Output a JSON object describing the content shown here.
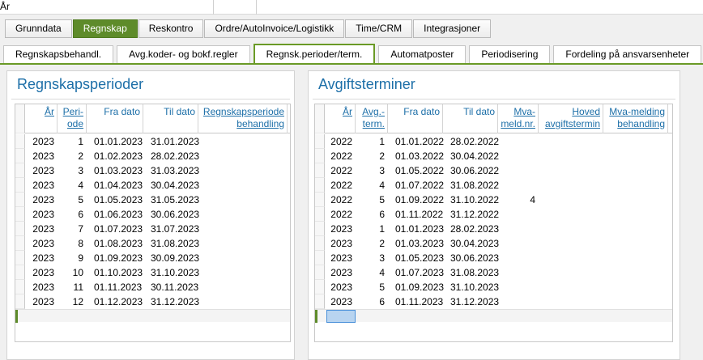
{
  "top_bar": {
    "label": "År"
  },
  "main_tabs": [
    {
      "label": "Grunndata",
      "active": false
    },
    {
      "label": "Regnskap",
      "active": true
    },
    {
      "label": "Reskontro",
      "active": false
    },
    {
      "label": "Ordre/AutoInvoice/Logistikk",
      "active": false
    },
    {
      "label": "Time/CRM",
      "active": false
    },
    {
      "label": "Integrasjoner",
      "active": false
    }
  ],
  "sub_tabs": [
    {
      "label": "Regnskapsbehandl.",
      "active": false
    },
    {
      "label": "Avg.koder- og bokf.regler",
      "active": false
    },
    {
      "label": "Regnsk.perioder/term.",
      "active": true
    },
    {
      "label": "Automatposter",
      "active": false
    },
    {
      "label": "Periodisering",
      "active": false
    },
    {
      "label": "Fordeling på ansvarsenheter",
      "active": false
    }
  ],
  "periods_panel": {
    "title": "Regnskapsperioder",
    "headers": [
      "År",
      "Peri-\node",
      "Fra dato",
      "Til dato",
      "Regnskapsperiode\nbehandling"
    ],
    "rows": [
      [
        "2023",
        "1",
        "01.01.2023",
        "31.01.2023",
        ""
      ],
      [
        "2023",
        "2",
        "01.02.2023",
        "28.02.2023",
        ""
      ],
      [
        "2023",
        "3",
        "01.03.2023",
        "31.03.2023",
        ""
      ],
      [
        "2023",
        "4",
        "01.04.2023",
        "30.04.2023",
        ""
      ],
      [
        "2023",
        "5",
        "01.05.2023",
        "31.05.2023",
        ""
      ],
      [
        "2023",
        "6",
        "01.06.2023",
        "30.06.2023",
        ""
      ],
      [
        "2023",
        "7",
        "01.07.2023",
        "31.07.2023",
        ""
      ],
      [
        "2023",
        "8",
        "01.08.2023",
        "31.08.2023",
        ""
      ],
      [
        "2023",
        "9",
        "01.09.2023",
        "30.09.2023",
        ""
      ],
      [
        "2023",
        "10",
        "01.10.2023",
        "31.10.2023",
        ""
      ],
      [
        "2023",
        "11",
        "01.11.2023",
        "30.11.2023",
        ""
      ],
      [
        "2023",
        "12",
        "01.12.2023",
        "31.12.2023",
        ""
      ]
    ]
  },
  "terms_panel": {
    "title": "Avgiftsterminer",
    "headers": [
      "År",
      "Avg.-\nterm.",
      "Fra dato",
      "Til dato",
      "Mva-\nmeld.nr.",
      "Hoved\navgiftstermin",
      "Mva-melding\nbehandling"
    ],
    "rows": [
      [
        "2022",
        "1",
        "01.01.2022",
        "28.02.2022",
        "",
        "",
        ""
      ],
      [
        "2022",
        "2",
        "01.03.2022",
        "30.04.2022",
        "",
        "",
        ""
      ],
      [
        "2022",
        "3",
        "01.05.2022",
        "30.06.2022",
        "",
        "",
        ""
      ],
      [
        "2022",
        "4",
        "01.07.2022",
        "31.08.2022",
        "",
        "",
        ""
      ],
      [
        "2022",
        "5",
        "01.09.2022",
        "31.10.2022",
        "4",
        "",
        ""
      ],
      [
        "2022",
        "6",
        "01.11.2022",
        "31.12.2022",
        "",
        "",
        ""
      ],
      [
        "2023",
        "1",
        "01.01.2023",
        "28.02.2023",
        "",
        "",
        ""
      ],
      [
        "2023",
        "2",
        "01.03.2023",
        "30.04.2023",
        "",
        "",
        ""
      ],
      [
        "2023",
        "3",
        "01.05.2023",
        "30.06.2023",
        "",
        "",
        ""
      ],
      [
        "2023",
        "4",
        "01.07.2023",
        "31.08.2023",
        "",
        "",
        ""
      ],
      [
        "2023",
        "5",
        "01.09.2023",
        "31.10.2023",
        "",
        "",
        ""
      ],
      [
        "2023",
        "6",
        "01.11.2023",
        "31.12.2023",
        "",
        "",
        ""
      ]
    ]
  },
  "colors": {
    "accent_green": "#5e8b2a",
    "link_blue": "#1d6fa8",
    "selection": "#b8d4f0"
  }
}
